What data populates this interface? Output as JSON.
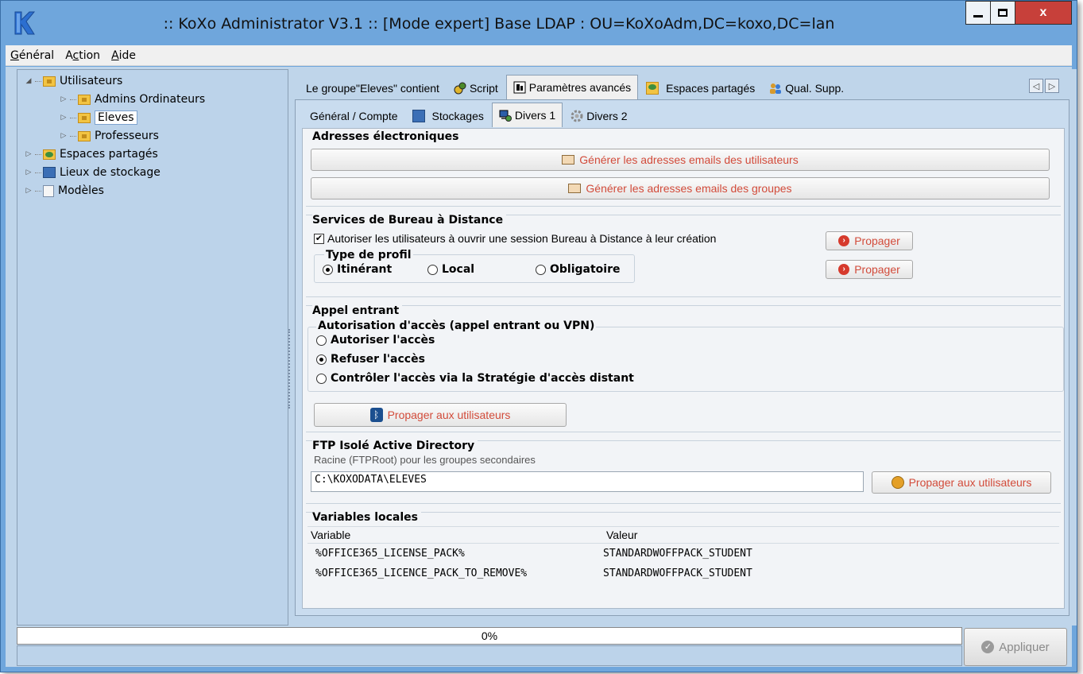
{
  "window": {
    "title": ":: KoXo Administrator V3.1 :: [Mode expert] Base LDAP : OU=KoXoAdm,DC=koxo,DC=lan",
    "accent_color": "#6fa6dc"
  },
  "menubar": {
    "items": [
      {
        "label": "Général",
        "underline": "G"
      },
      {
        "label": "Action",
        "underline": "c"
      },
      {
        "label": "Aide",
        "underline": "A"
      }
    ]
  },
  "tree": {
    "nodes": [
      {
        "label": "Utilisateurs",
        "icon": "folder-icon",
        "expanded": true
      },
      {
        "label": "Admins Ordinateurs",
        "icon": "folder-icon"
      },
      {
        "label": "Eleves",
        "icon": "folder-icon",
        "selected": true
      },
      {
        "label": "Professeurs",
        "icon": "folder-icon"
      },
      {
        "label": "Espaces partagés",
        "icon": "share-icon"
      },
      {
        "label": "Lieux de stockage",
        "icon": "disk-icon"
      },
      {
        "label": "Modèles",
        "icon": "template-icon"
      }
    ]
  },
  "tabs_top": [
    {
      "label": "Le groupe\"Eleves\" contient",
      "icon": ""
    },
    {
      "label": "Script",
      "icon": "script-icon"
    },
    {
      "label": "Paramètres avancés",
      "icon": "settings-icon",
      "active": true
    },
    {
      "label": "Espaces partagés",
      "icon": "share-icon"
    },
    {
      "label": "Qual. Supp.",
      "icon": "users-icon"
    }
  ],
  "tabs_sub": [
    {
      "label": "Général / Compte",
      "icon": ""
    },
    {
      "label": "Stockages",
      "icon": "disk-icon"
    },
    {
      "label": "Divers 1",
      "icon": "computer-icon",
      "active": true
    },
    {
      "label": "Divers 2",
      "icon": "gear-icon"
    }
  ],
  "email": {
    "title": "Adresses électroniques",
    "btn_users": "Générer les adresses emails des utilisateurs",
    "btn_groups": "Générer les adresses emails des groupes"
  },
  "rds": {
    "title": "Services de Bureau à Distance",
    "allow_label": "Autoriser les utilisateurs à ouvrir une session Bureau à Distance à leur création",
    "allow_checked": true,
    "propagate_1": "Propager",
    "propagate_2": "Propager",
    "profile_title": "Type de profil",
    "profile_options": [
      "Itinérant",
      "Local",
      "Obligatoire"
    ],
    "profile_selected": "Itinérant"
  },
  "dialin": {
    "title": "Appel entrant",
    "access_title": "Autorisation d'accès (appel entrant ou VPN)",
    "options": [
      "Autoriser l'accès",
      "Refuser l'accès",
      "Contrôler l'accès via la Stratégie d'accès distant"
    ],
    "selected": "Refuser l'accès",
    "propagate_label": "Propager aux utilisateurs"
  },
  "ftp": {
    "title": "FTP Isolé Active Directory",
    "hint": "Racine (FTPRoot) pour les groupes secondaires",
    "value": "C:\\KOXODATA\\ELEVES",
    "propagate_label": "Propager aux utilisateurs"
  },
  "variables": {
    "title": "Variables locales",
    "headers": [
      "Variable",
      "Valeur"
    ],
    "rows": [
      [
        "%OFFICE365_LICENSE_PACK%",
        "STANDARDWOFFPACK_STUDENT"
      ],
      [
        "%OFFICE365_LICENCE_PACK_TO_REMOVE%",
        "STANDARDWOFFPACK_STUDENT"
      ]
    ]
  },
  "status": {
    "progress_text": "0%",
    "progress_value": 0,
    "apply_label": "Appliquer"
  }
}
